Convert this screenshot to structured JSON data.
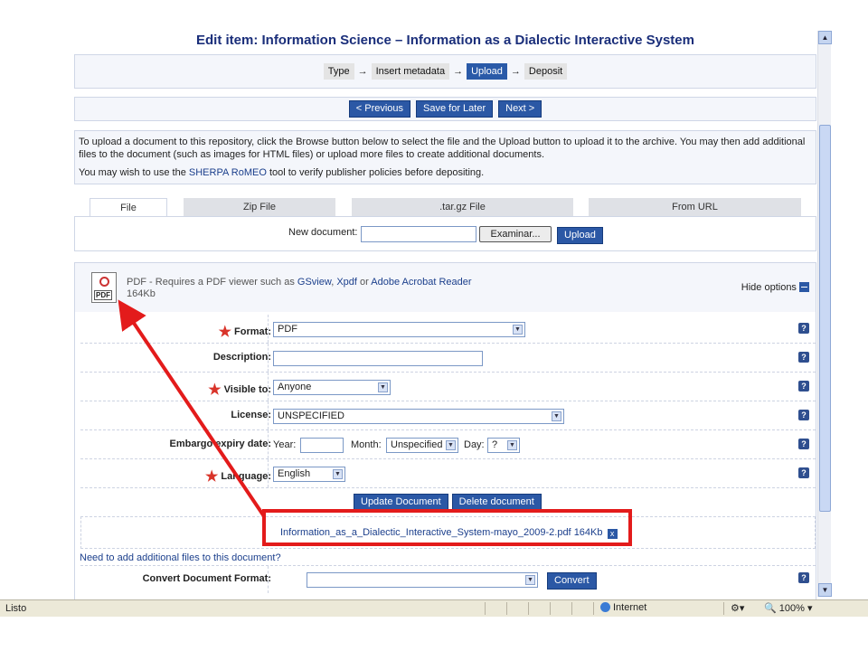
{
  "page": {
    "title": "Edit item: Information Science – Information as a Dialectic Interactive System"
  },
  "steps": [
    {
      "label": "Type",
      "active": false
    },
    {
      "label": "Insert metadata",
      "active": false
    },
    {
      "label": "Upload",
      "active": true
    },
    {
      "label": "Deposit",
      "active": false
    }
  ],
  "nav": {
    "previous": "< Previous",
    "save_later": "Save for Later",
    "next": "Next >"
  },
  "intro": {
    "line1": "To upload a document to this repository, click the Browse button below to select the file and the Upload button to upload it to the archive. You may then add additional files to the document (such as images for HTML files) or upload more files to create additional documents.",
    "line2_pre": "You may wish to use the ",
    "line2_link": "SHERPA RoMEO",
    "line2_post": " tool to verify publisher policies before depositing."
  },
  "tabs": [
    "File",
    "Zip File",
    ".tar.gz File",
    "From URL"
  ],
  "upload": {
    "new_document_label": "New document:",
    "browse_label": "Examinar...",
    "upload_label": "Upload"
  },
  "document": {
    "icon_label": "PDF",
    "desc_pre": "PDF - Requires a PDF viewer such as ",
    "desc_link1": "GSview",
    "desc_sep1": ", ",
    "desc_link2": "Xpdf",
    "desc_sep2": " or ",
    "desc_link3": "Adobe Acrobat Reader",
    "size": "164Kb",
    "hide_options": "Hide options"
  },
  "fields": {
    "format_label": "Format:",
    "format_value": "PDF",
    "description_label": "Description:",
    "visible_label": "Visible to:",
    "visible_value": "Anyone",
    "license_label": "License:",
    "license_value": "UNSPECIFIED",
    "embargo_label": "Embargo expiry date:",
    "year_label": "Year:",
    "month_label": "Month:",
    "month_value": "Unspecified",
    "day_label": "Day:",
    "day_value": "?",
    "language_label": "Language:",
    "language_value": "English",
    "help": "?"
  },
  "doc_actions": {
    "update": "Update Document",
    "delete": "Delete document"
  },
  "file": {
    "name": "Information_as_a_Dialectic_Interactive_System-mayo_2009-2.pdf",
    "size": "164Kb",
    "remove": "x"
  },
  "more": {
    "need_more": "Need to add additional files to this document?",
    "convert_label": "Convert Document Format:",
    "convert_button": "Convert"
  },
  "statusbar": {
    "status": "Listo",
    "zone": "Internet",
    "zoom": "100%"
  },
  "colors": {
    "title": "#1a2e7a",
    "button": "#2b58a5",
    "annotation": "#e31b1b"
  }
}
